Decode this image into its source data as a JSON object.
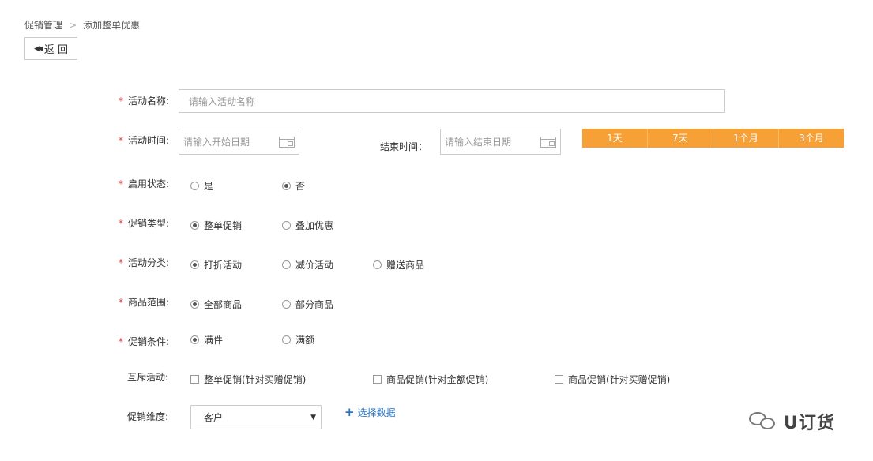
{
  "breadcrumb": {
    "parent": "促销管理",
    "separator": ">",
    "current": "添加整单优惠"
  },
  "back_button": {
    "icon": "double-left-arrow",
    "label": "返 回"
  },
  "required_mark": "*",
  "activity_name": {
    "label": "活动名称:",
    "placeholder": "请输入活动名称"
  },
  "activity_time": {
    "label": "活动时间:",
    "start_placeholder": "请输入开始日期",
    "end_label": "结束时间：",
    "end_placeholder": "请输入结束日期",
    "quick_ranges": [
      "1天",
      "7天",
      "1个月",
      "3个月"
    ],
    "quick_color": "#f7a035"
  },
  "enable_status": {
    "label": "启用状态:",
    "options": [
      "是",
      "否"
    ],
    "selected": "否"
  },
  "promo_type": {
    "label": "促销类型:",
    "options": [
      "整单促销",
      "叠加优惠"
    ],
    "selected": "整单促销"
  },
  "activity_category": {
    "label": "活动分类:",
    "options": [
      "打折活动",
      "减价活动",
      "赠送商品"
    ],
    "selected": "打折活动"
  },
  "product_scope": {
    "label": "商品范围:",
    "options": [
      "全部商品",
      "部分商品"
    ],
    "selected": "全部商品"
  },
  "promo_condition": {
    "label": "促销条件:",
    "options": [
      "满件",
      "满额"
    ],
    "selected": "满件"
  },
  "mutex_activities": {
    "label": "互斥活动:",
    "options": [
      "整单促销(针对买赠促销)",
      "商品促销(针对金额促销)",
      "商品促销(针对买赠促销)"
    ]
  },
  "promo_dimension": {
    "label": "促销维度:",
    "selected": "客户",
    "add_link": "选择数据"
  },
  "watermark": {
    "brand": "U订货"
  }
}
